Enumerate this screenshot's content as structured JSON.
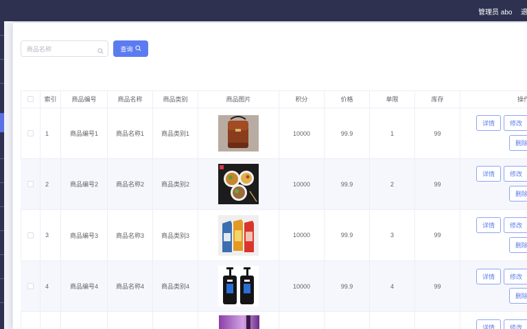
{
  "header": {
    "admin_label": "管理员 abo",
    "logout_label": "退"
  },
  "search": {
    "placeholder": "商品名称",
    "value": "",
    "button_label": "查询"
  },
  "table": {
    "columns": [
      "索引",
      "商品编号",
      "商品名称",
      "商品类别",
      "商品图片",
      "积分",
      "价格",
      "单限",
      "库存",
      "操作"
    ],
    "rows": [
      {
        "index": "1",
        "code": "商品编号1",
        "name": "商品名称1",
        "category": "商品类别1",
        "image": "brown-leather-bag",
        "points": "10000",
        "price": "99.9",
        "limit": "1",
        "stock": "99"
      },
      {
        "index": "2",
        "code": "商品编号2",
        "name": "商品名称2",
        "category": "商品类别2",
        "image": "food-bowls",
        "points": "10000",
        "price": "99.9",
        "limit": "2",
        "stock": "99"
      },
      {
        "index": "3",
        "code": "商品编号3",
        "name": "商品名称3",
        "category": "商品类别3",
        "image": "colorful-juice-cartons",
        "points": "10000",
        "price": "99.9",
        "limit": "3",
        "stock": "99"
      },
      {
        "index": "4",
        "code": "商品编号4",
        "name": "商品名称4",
        "category": "商品类别4",
        "image": "black-pump-bottles",
        "points": "10000",
        "price": "99.9",
        "limit": "4",
        "stock": "99"
      },
      {
        "index": "",
        "code": "",
        "name": "",
        "category": "",
        "image": "purple-product",
        "points": "",
        "price": "",
        "limit": "",
        "stock": ""
      }
    ],
    "actions": {
      "detail": "详情",
      "edit": "修改",
      "delete": "删除"
    }
  },
  "colors": {
    "topbar": "#2e3150",
    "accent": "#5b7cf0",
    "stripe": "#f6f7fd"
  }
}
